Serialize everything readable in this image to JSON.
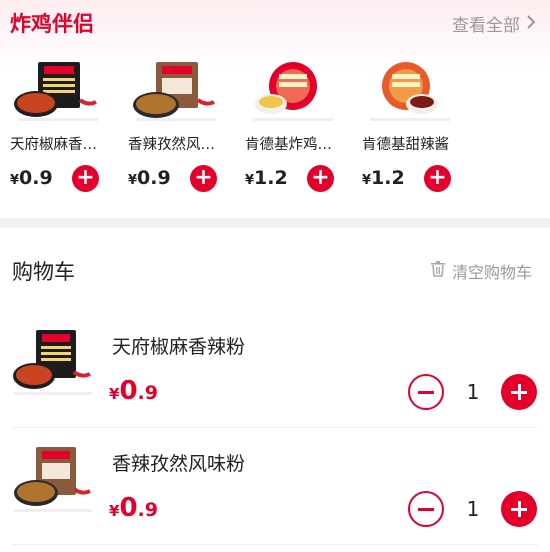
{
  "companion": {
    "title": "炸鸡伴侣",
    "view_all": "查看全部",
    "items": [
      {
        "name": "天府椒麻香…",
        "price": "0.9"
      },
      {
        "name": "香辣孜然风…",
        "price": "0.9"
      },
      {
        "name": "肯德基炸鸡…",
        "price": "1.2"
      },
      {
        "name": "肯德基甜辣酱",
        "price": "1.2"
      }
    ]
  },
  "currency": "¥",
  "add_symbol": "+",
  "cart": {
    "title": "购物车",
    "clear_label": "清空购物车",
    "items": [
      {
        "name": "天府椒麻香辣粉",
        "price_int": "0",
        "price_dec": ".9",
        "qty": "1"
      },
      {
        "name": "香辣孜然风味粉",
        "price_int": "0",
        "price_dec": ".9",
        "qty": "1"
      }
    ]
  },
  "colors": {
    "accent": "#e4002b",
    "muted": "#999999"
  },
  "icons": [
    "chevron-right-icon",
    "trash-icon",
    "plus-icon",
    "minus-icon"
  ]
}
